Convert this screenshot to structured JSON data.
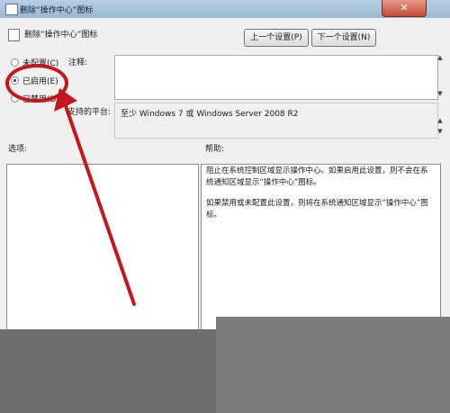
{
  "window": {
    "title": "删除“操作中心”图标",
    "close_glyph": "✕",
    "header": "删除“操作中心”图标"
  },
  "navigation": {
    "prev_label": "上一个设置(P)",
    "next_label": "下一个设置(N)"
  },
  "radios": [
    {
      "label": "未配置(C)",
      "selected": false
    },
    {
      "label": "已启用(E)",
      "selected": true
    },
    {
      "label": "已禁用(D)",
      "selected": false
    }
  ],
  "form": {
    "comment_label": "注释:",
    "comment_value": "",
    "platform_label": "支持的平台:",
    "platform_value": "至少 Windows 7 或 Windows Server 2008 R2"
  },
  "sections": {
    "options_label": "选项:",
    "help_label": "帮助:"
  },
  "help": {
    "paragraph_1": "阻止在系统控制区域显示操作中心。如果启用此设置，则不会在系统通知区域显示“操作中心”图标。",
    "paragraph_2": "如果禁用或未配置此设置，则将在系统通知区域显示“操作中心”图标。"
  },
  "annotation": {
    "color": "#c8151b"
  }
}
